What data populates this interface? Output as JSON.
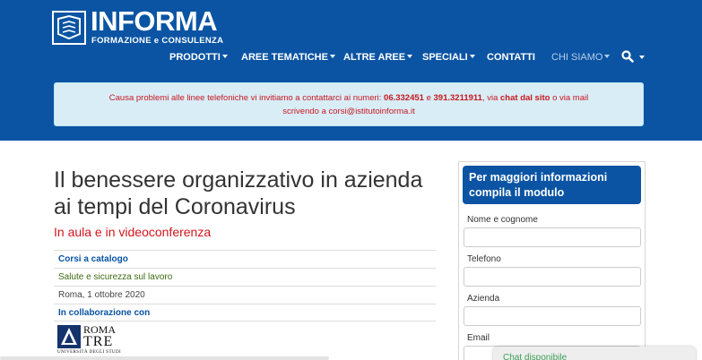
{
  "brand": {
    "name": "INFORMA",
    "tagline": "FORMAZIONE e CONSULENZA",
    "color": "#0a54a3"
  },
  "nav": {
    "items": [
      {
        "label": "PRODOTTI",
        "caret": true
      },
      {
        "label": "AREE TEMATICHE",
        "caret": true
      },
      {
        "label": "ALTRE AREE",
        "caret": true
      },
      {
        "label": "SPECIALI",
        "caret": true
      },
      {
        "label": "CONTATTI",
        "caret": false
      },
      {
        "label": "CHI SIAMO",
        "caret": true,
        "active": true
      }
    ],
    "search_icon": "search-icon"
  },
  "alert": {
    "prefix": "Causa problemi alle linee telefoniche vi invitiamo a contattarci ai numeri: ",
    "phone1": "06.332451",
    "conj": " e ",
    "phone2": "391.3211911",
    "mid": ", via ",
    "chat": "chat dal sito",
    "suffix": " o via mail",
    "line2": "scrivendo a ",
    "email": "corsi@istitutoinforma.it",
    "text_color": "#c7181e",
    "background": "#d9edf7"
  },
  "course": {
    "title": "Il benessere organizzativo in azienda ai tempi del Coronavirus",
    "subtitle": "In aula e in videoconferenza",
    "category": "Corsi a catalogo",
    "area": "Salute e sicurezza sul lavoro",
    "date": "Roma, 1 ottobre 2020",
    "partner_label": "In collaborazione con",
    "partner_logo": {
      "line1": "ROMA",
      "line2": "TRE",
      "line3": "UNIVERSITÀ DEGLI STUDI"
    }
  },
  "form": {
    "heading": "Per maggiori informazioni compila il modulo",
    "fields": [
      {
        "label": "Nome e cognome",
        "value": ""
      },
      {
        "label": "Telefono",
        "value": ""
      },
      {
        "label": "Azienda",
        "value": ""
      },
      {
        "label": "Email",
        "value": ""
      }
    ]
  },
  "chat": {
    "label": "Chat disponibile",
    "color": "#3ea05a"
  }
}
